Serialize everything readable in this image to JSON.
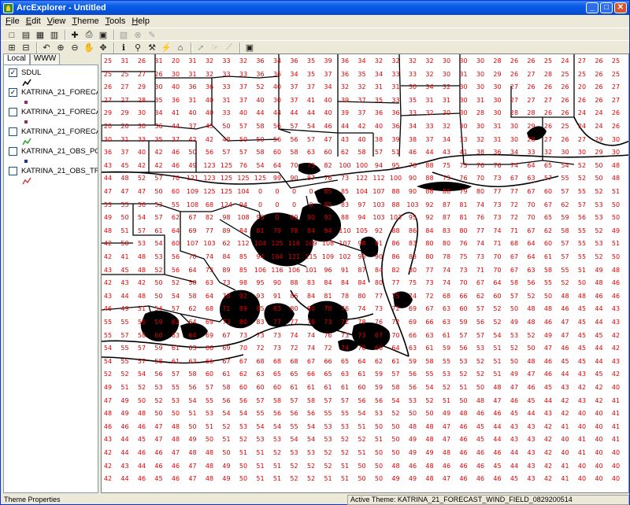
{
  "window": {
    "title": "ArcExplorer - Untitled"
  },
  "menu": [
    "File",
    "Edit",
    "View",
    "Theme",
    "Tools",
    "Help"
  ],
  "toolbar1": [
    {
      "icon": "new-document-icon",
      "glyph": "□"
    },
    {
      "icon": "open-folder-icon",
      "glyph": "▤"
    },
    {
      "icon": "save-icon",
      "glyph": "▦"
    },
    {
      "icon": "open-project-icon",
      "glyph": "▥"
    },
    {
      "icon": "add-theme-icon",
      "glyph": "✚"
    },
    {
      "icon": "print-icon",
      "glyph": "⎙"
    },
    {
      "icon": "layout-icon",
      "glyph": "▣"
    },
    {
      "icon": "query-builder-icon",
      "glyph": "▧",
      "disabled": true
    },
    {
      "icon": "clear-selection-icon",
      "glyph": "⊗",
      "disabled": true
    },
    {
      "icon": "edit-icon",
      "glyph": "✎",
      "disabled": true
    }
  ],
  "toolbar2": [
    {
      "icon": "add-data-icon",
      "glyph": "⊞"
    },
    {
      "icon": "remove-data-icon",
      "glyph": "⊟"
    },
    {
      "icon": "undo-icon",
      "glyph": "↶"
    },
    {
      "icon": "zoom-in-icon",
      "glyph": "⊕"
    },
    {
      "icon": "zoom-out-icon",
      "glyph": "⊖"
    },
    {
      "icon": "hand-pan-icon",
      "glyph": "✋"
    },
    {
      "icon": "pan-arrows-icon",
      "glyph": "✥"
    },
    {
      "icon": "identify-icon",
      "glyph": "ℹ"
    },
    {
      "icon": "find-icon",
      "glyph": "⚲"
    },
    {
      "icon": "measure-icon",
      "glyph": "⚒"
    },
    {
      "icon": "hotlink-icon",
      "glyph": "⚡"
    },
    {
      "icon": "map-tips-icon",
      "glyph": "⌂"
    },
    {
      "icon": "select-features-icon",
      "glyph": "➚",
      "disabled": true
    },
    {
      "icon": "select-by-graphic-icon",
      "glyph": "☞",
      "disabled": true
    },
    {
      "icon": "select-by-line-icon",
      "glyph": "⟋",
      "disabled": true
    },
    {
      "icon": "map-overview-icon",
      "glyph": "▣"
    }
  ],
  "tabs": [
    "Local",
    "WWW"
  ],
  "layers": [
    {
      "name": "SDUL",
      "checked": true,
      "legend": "line",
      "color": "#000000"
    },
    {
      "name": "KATRINA_21_FORECAST_WIND_FIELD",
      "checked": true,
      "legend": "point",
      "color": "#8b2f6a"
    },
    {
      "name": "KATRINA_21_FORECAST_POINTS",
      "checked": false,
      "legend": "point",
      "color": "#8b2f6a"
    },
    {
      "name": "KATRINA_21_FORECAST_TRACK",
      "checked": false,
      "legend": "line",
      "color": "#2aa02a"
    },
    {
      "name": "KATRINA_21_OBS_POINTS",
      "checked": false,
      "legend": "point",
      "color": "#1a2fb5"
    },
    {
      "name": "KATRINA_21_OBS_TRACK",
      "checked": false,
      "legend": "line",
      "color": "#d04040"
    }
  ],
  "status": {
    "left": "Theme Properties",
    "right": "Active Theme: KATRINA_21_FORECAST_WIND_FIELD_0829200514"
  },
  "colors": {
    "wind_label": "#e00000",
    "title_bar": "#0a5ce6",
    "map_bg": "#ffffff"
  },
  "wind_field": {
    "rows": [
      [
        25,
        31,
        26,
        31,
        20,
        31,
        32,
        33,
        32,
        36,
        34,
        36,
        35,
        39,
        36,
        34,
        32,
        32,
        32,
        32,
        30,
        30,
        30,
        28,
        26,
        26,
        25,
        24,
        27,
        26,
        25
      ],
      [
        25,
        25,
        27,
        26,
        30,
        31,
        32,
        33,
        33,
        36,
        36,
        34,
        35,
        37,
        36,
        35,
        34,
        33,
        33,
        32,
        30,
        31,
        30,
        29,
        26,
        27,
        28,
        25,
        25,
        26,
        25
      ],
      [
        26,
        27,
        29,
        30,
        40,
        36,
        36,
        33,
        37,
        52,
        40,
        37,
        37,
        34,
        32,
        32,
        31,
        31,
        30,
        34,
        32,
        30,
        30,
        30,
        27,
        26,
        26,
        26,
        20,
        26,
        27
      ],
      [
        27,
        27,
        28,
        35,
        36,
        31,
        40,
        31,
        37,
        40,
        30,
        37,
        41,
        40,
        39,
        37,
        35,
        33,
        35,
        31,
        31,
        30,
        31,
        30,
        27,
        27,
        27,
        26,
        26,
        26,
        27
      ],
      [
        29,
        29,
        30,
        34,
        41,
        40,
        40,
        33,
        40,
        44,
        44,
        44,
        44,
        40,
        39,
        37,
        36,
        36,
        33,
        32,
        30,
        30,
        28,
        30,
        28,
        28,
        26,
        26,
        24,
        24,
        26
      ],
      [
        20,
        20,
        30,
        36,
        44,
        37,
        45,
        50,
        57,
        58,
        56,
        57,
        54,
        46,
        44,
        42,
        40,
        36,
        34,
        33,
        32,
        30,
        30,
        31,
        30,
        29,
        26,
        25,
        24,
        24,
        26
      ],
      [
        30,
        31,
        33,
        35,
        37,
        42,
        42,
        48,
        50,
        50,
        56,
        56,
        57,
        47,
        43,
        40,
        38,
        39,
        38,
        37,
        34,
        33,
        32,
        31,
        30,
        28,
        27,
        26,
        27,
        29,
        30
      ],
      [
        36,
        37,
        40,
        42,
        46,
        50,
        56,
        57,
        57,
        58,
        60,
        58,
        63,
        60,
        62,
        58,
        57,
        51,
        46,
        44,
        43,
        41,
        38,
        36,
        34,
        33,
        32,
        30,
        30,
        29,
        30
      ],
      [
        43,
        45,
        42,
        42,
        46,
        49,
        123,
        125,
        76,
        54,
        64,
        70,
        73,
        82,
        100,
        100,
        94,
        95,
        76,
        88,
        75,
        73,
        76,
        76,
        74,
        64,
        65,
        54,
        52,
        50,
        48
      ],
      [
        44,
        48,
        52,
        57,
        70,
        121,
        123,
        125,
        125,
        125,
        99,
        90,
        87,
        76,
        73,
        122,
        112,
        100,
        90,
        88,
        73,
        76,
        70,
        73,
        67,
        63,
        57,
        55,
        52,
        50,
        48
      ],
      [
        47,
        47,
        47,
        50,
        60,
        109,
        125,
        125,
        104,
        0,
        0,
        0,
        0,
        85,
        85,
        104,
        107,
        88,
        90,
        88,
        88,
        79,
        80,
        77,
        77,
        67,
        60,
        57,
        55,
        52,
        51
      ],
      [
        53,
        55,
        56,
        53,
        55,
        108,
        68,
        124,
        94,
        0,
        0,
        0,
        0,
        85,
        83,
        97,
        103,
        88,
        103,
        92,
        87,
        81,
        74,
        73,
        72,
        70,
        67,
        62,
        57,
        53,
        50
      ],
      [
        49,
        50,
        54,
        57,
        62,
        67,
        82,
        98,
        108,
        99,
        0,
        99,
        90,
        92,
        88,
        94,
        103,
        103,
        95,
        92,
        87,
        81,
        76,
        73,
        72,
        70,
        65,
        59,
        56,
        53,
        50
      ],
      [
        48,
        51,
        57,
        61,
        64,
        69,
        77,
        89,
        84,
        81,
        79,
        78,
        84,
        94,
        110,
        105,
        92,
        88,
        86,
        84,
        83,
        80,
        77,
        74,
        71,
        67,
        62,
        58,
        55,
        52,
        49
      ],
      [
        42,
        50,
        53,
        54,
        60,
        107,
        103,
        62,
        112,
        104,
        125,
        116,
        109,
        108,
        107,
        98,
        91,
        86,
        83,
        80,
        80,
        76,
        74,
        71,
        68,
        64,
        60,
        57,
        55,
        53,
        51
      ],
      [
        42,
        41,
        48,
        53,
        56,
        70,
        74,
        84,
        85,
        94,
        104,
        121,
        115,
        109,
        102,
        95,
        90,
        86,
        83,
        80,
        78,
        75,
        73,
        70,
        67,
        64,
        61,
        57,
        55,
        52,
        50
      ],
      [
        43,
        45,
        48,
        52,
        56,
        64,
        73,
        89,
        85,
        106,
        116,
        106,
        101,
        96,
        91,
        87,
        84,
        82,
        80,
        77,
        74,
        73,
        71,
        70,
        67,
        63,
        58,
        55,
        51,
        49,
        48
      ],
      [
        42,
        43,
        42,
        50,
        52,
        58,
        63,
        73,
        98,
        95,
        90,
        88,
        83,
        84,
        84,
        84,
        80,
        77,
        75,
        73,
        74,
        70,
        67,
        64,
        58,
        56,
        55,
        52,
        50,
        48,
        46
      ],
      [
        43,
        44,
        48,
        50,
        54,
        58,
        64,
        78,
        92,
        93,
        91,
        86,
        84,
        81,
        78,
        80,
        77,
        75,
        74,
        72,
        68,
        66,
        62,
        60,
        57,
        52,
        50,
        48,
        48,
        46,
        46
      ],
      [
        46,
        49,
        51,
        54,
        57,
        62,
        68,
        71,
        89,
        85,
        83,
        80,
        80,
        78,
        76,
        74,
        73,
        72,
        69,
        67,
        63,
        60,
        57,
        52,
        50,
        48,
        48,
        46,
        45,
        44,
        43
      ],
      [
        55,
        55,
        56,
        59,
        62,
        64,
        69,
        73,
        80,
        83,
        77,
        77,
        76,
        73,
        72,
        78,
        76,
        72,
        69,
        66,
        63,
        59,
        56,
        52,
        49,
        48,
        46,
        47,
        45,
        44,
        43
      ],
      [
        55,
        57,
        58,
        60,
        63,
        64,
        69,
        67,
        73,
        73,
        73,
        74,
        74,
        76,
        73,
        73,
        67,
        70,
        66,
        63,
        61,
        57,
        57,
        54,
        53,
        52,
        49,
        47,
        45,
        45,
        42
      ],
      [
        54,
        55,
        57,
        59,
        61,
        63,
        66,
        69,
        70,
        72,
        73,
        72,
        74,
        72,
        74,
        70,
        66,
        64,
        63,
        61,
        59,
        56,
        53,
        51,
        52,
        50,
        47,
        46,
        45,
        44,
        42
      ],
      [
        54,
        55,
        57,
        58,
        61,
        63,
        66,
        67,
        67,
        68,
        68,
        68,
        67,
        66,
        65,
        64,
        62,
        61,
        59,
        58,
        55,
        53,
        52,
        51,
        50,
        48,
        46,
        45,
        45,
        44,
        43
      ],
      [
        52,
        52,
        54,
        56,
        57,
        58,
        60,
        61,
        62,
        63,
        65,
        65,
        66,
        65,
        63,
        61,
        59,
        57,
        56,
        55,
        53,
        52,
        52,
        51,
        49,
        47,
        46,
        44,
        43,
        45,
        42
      ],
      [
        49,
        51,
        52,
        53,
        55,
        56,
        57,
        58,
        60,
        60,
        60,
        61,
        61,
        61,
        61,
        60,
        59,
        58,
        56,
        54,
        52,
        51,
        50,
        48,
        47,
        46,
        45,
        43,
        42,
        42,
        40
      ],
      [
        47,
        49,
        50,
        52,
        53,
        54,
        55,
        56,
        56,
        57,
        58,
        57,
        58,
        57,
        57,
        56,
        56,
        54,
        53,
        52,
        51,
        50,
        48,
        47,
        46,
        45,
        44,
        42,
        43,
        42,
        41
      ],
      [
        48,
        49,
        48,
        50,
        50,
        51,
        53,
        54,
        54,
        55,
        56,
        56,
        56,
        55,
        55,
        54,
        53,
        52,
        50,
        50,
        49,
        48,
        46,
        46,
        45,
        44,
        43,
        42,
        40,
        40,
        41
      ],
      [
        46,
        46,
        46,
        47,
        48,
        50,
        51,
        52,
        53,
        54,
        54,
        55,
        54,
        53,
        53,
        51,
        50,
        50,
        48,
        48,
        47,
        46,
        45,
        44,
        43,
        43,
        42,
        41,
        40,
        40,
        41
      ],
      [
        43,
        44,
        45,
        47,
        48,
        49,
        50,
        51,
        52,
        53,
        53,
        54,
        54,
        53,
        52,
        52,
        51,
        50,
        49,
        48,
        47,
        46,
        45,
        44,
        43,
        43,
        42,
        40,
        41,
        40,
        41
      ],
      [
        42,
        44,
        46,
        46,
        47,
        48,
        48,
        50,
        51,
        51,
        52,
        53,
        53,
        52,
        52,
        51,
        50,
        50,
        49,
        49,
        48,
        46,
        46,
        46,
        44,
        43,
        42,
        40,
        41,
        40,
        40
      ],
      [
        42,
        43,
        44,
        46,
        46,
        47,
        48,
        49,
        50,
        51,
        51,
        52,
        52,
        52,
        51,
        50,
        50,
        48,
        46,
        48,
        46,
        46,
        46,
        45,
        44,
        43,
        42,
        41,
        40,
        40,
        40
      ],
      [
        42,
        44,
        46,
        45,
        46,
        47,
        48,
        49,
        50,
        51,
        51,
        52,
        52,
        51,
        51,
        50,
        50,
        49,
        49,
        48,
        47,
        46,
        46,
        46,
        45,
        43,
        42,
        41,
        40,
        40,
        40
      ]
    ]
  }
}
